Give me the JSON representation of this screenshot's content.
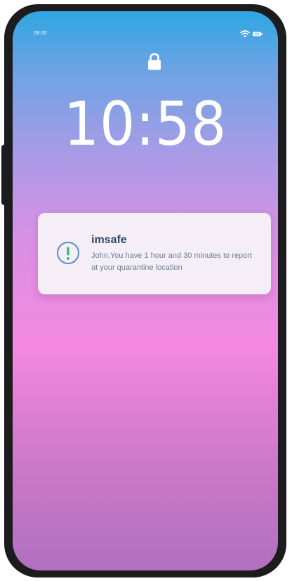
{
  "status_bar": {
    "time": "08:00",
    "wifi_icon": "wifi-icon",
    "battery_icon": "battery-icon"
  },
  "lock_screen": {
    "lock_icon": "lock-icon",
    "clock": "10:58"
  },
  "notification": {
    "icon": "alert-icon",
    "app_name": "imsafe",
    "message": "John,You have 1 hour and 30 minutes to report at your quarantine location"
  },
  "colors": {
    "notification_title": "#2d4a66",
    "notification_body": "#6a7f92",
    "alert_circle": "#5b8fc7",
    "alert_mark": "#22b573"
  }
}
